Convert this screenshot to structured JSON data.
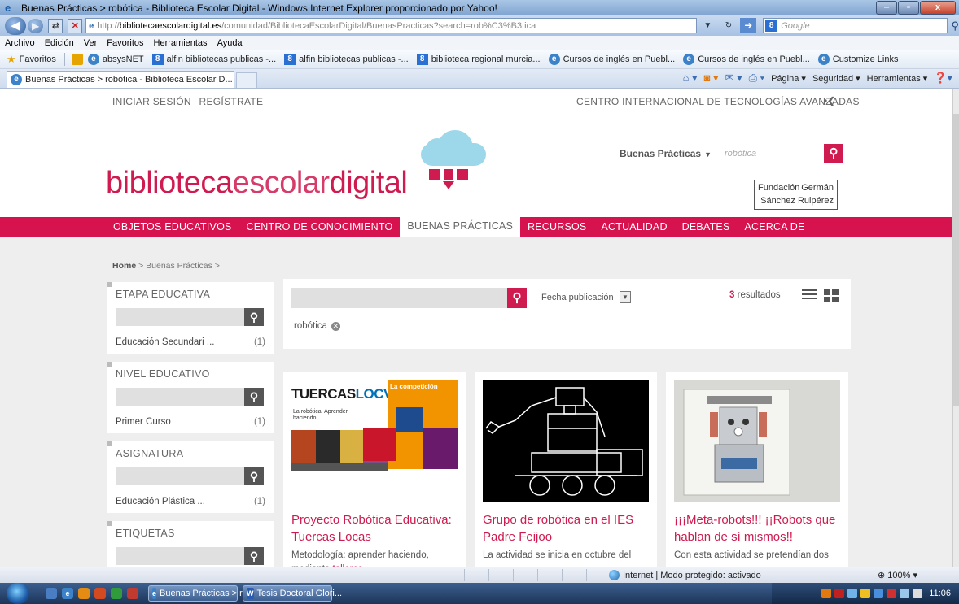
{
  "window": {
    "title": "Buenas Prácticas > robótica - Biblioteca Escolar Digital - Windows Internet Explorer proporcionado por Yahoo!",
    "url_prefix": "http://",
    "url_domain": "bibliotecaescolardigital.es",
    "url_path": "/comunidad/BibliotecaEscolarDigital/BuenasPracticas?search=rob%C3%B3tica",
    "search_placeholder": "Google"
  },
  "menu": [
    "Archivo",
    "Edición",
    "Ver",
    "Favoritos",
    "Herramientas",
    "Ayuda"
  ],
  "favorites": {
    "label": "Favoritos",
    "items": [
      {
        "label": "absysNET",
        "icon": "ie-icon"
      },
      {
        "label": "alfin bibliotecas publicas -...",
        "icon": "google-icon"
      },
      {
        "label": "alfin bibliotecas publicas -...",
        "icon": "google-icon"
      },
      {
        "label": "biblioteca regional murcia...",
        "icon": "google-icon"
      },
      {
        "label": "Cursos de inglés en Puebl...",
        "icon": "ie-icon"
      },
      {
        "label": "Cursos de inglés en Puebl...",
        "icon": "ie-icon"
      },
      {
        "label": "Customize Links",
        "icon": "ie-icon"
      }
    ]
  },
  "tab": {
    "label": "Buenas Prácticas > robótica - Biblioteca Escolar D..."
  },
  "commands": {
    "page": "Página ▾",
    "security": "Seguridad ▾",
    "tools": "Herramientas ▾"
  },
  "site": {
    "login": "INICIAR SESIÓN",
    "register": "REGÍSTRATE",
    "center": "CENTRO INTERNACIONAL DE TECNOLOGÍAS AVANZADAS",
    "logo_a": "biblioteca",
    "logo_b": "escolar",
    "logo_c": "digital",
    "search_scope": "Buenas Prácticas",
    "search_value": "robótica",
    "fundacion_1a": "Fundación",
    "fundacion_1b": "Germán",
    "fundacion_2": "Sánchez Ruipérez",
    "nav": [
      "OBJETOS EDUCATIVOS",
      "CENTRO DE CONOCIMIENTO",
      "BUENAS PRÁCTICAS",
      "RECURSOS",
      "ACTUALIDAD",
      "DEBATES",
      "ACERCA DE"
    ],
    "nav_active": "BUENAS PRÁCTICAS",
    "accent": "#d6124f"
  },
  "breadcrumb": {
    "home": "Home",
    "rest": " > Buenas Prácticas >"
  },
  "facets": [
    {
      "title": "ETAPA EDUCATIVA",
      "value": "Educación Secundari ...",
      "count": "(1)"
    },
    {
      "title": "NIVEL EDUCATIVO",
      "value": "Primer Curso",
      "count": "(1)"
    },
    {
      "title": "ASIGNATURA",
      "value": "Educación Plástica ...",
      "count": "(1)"
    },
    {
      "title": "ETIQUETAS",
      "value": "",
      "count": ""
    }
  ],
  "results": {
    "sort": "Fecha publicación",
    "count": "3",
    "count_label": "resultados",
    "tag": "robótica",
    "cards": [
      {
        "title": "Proyecto Robótica Educativa: Tuercas Locas",
        "desc": "Metodología: aprender haciendo, mediante ",
        "desc_link": "talleres",
        "desc_end": "."
      },
      {
        "title": "Grupo de robótica en el IES Padre Feijoo",
        "desc": "La actividad se inicia en octubre del"
      },
      {
        "title": "¡¡¡Meta-robots!!! ¡¡Robots que hablan de sí mismos!!",
        "desc": "Con esta actividad se pretendían dos"
      }
    ],
    "poster": {
      "title_a": "TUERCAS",
      "title_b": "LOCVS",
      "sub": "La robótica: Aprender haciendo",
      "head": "La competición"
    }
  },
  "status": {
    "zone": "Internet | Modo protegido: activado",
    "zoom": "100%"
  },
  "taskbar": {
    "task1": "Buenas Prácticas > r...",
    "task2": "Tesis Doctoral Glori...",
    "clock": "11:06"
  }
}
